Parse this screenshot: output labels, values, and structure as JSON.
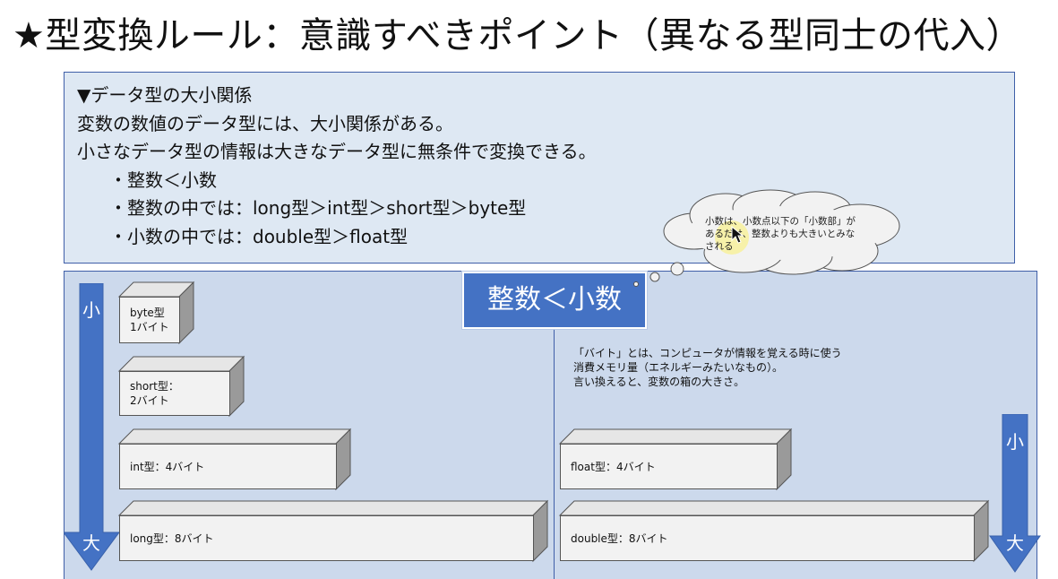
{
  "slide_title": "★型変換ルール：意識すべきポイント（異なる型同士の代入）",
  "info": {
    "heading": "▼データ型の大小関係",
    "line1": "変数の数値のデータ型には、大小関係がある。",
    "line2": "小さなデータ型の情報は大きなデータ型に無条件で変換できる。",
    "bullet1": "・整数＜小数",
    "bullet2": "・整数の中では：long型＞int型＞short型＞byte型",
    "bullet3": "・小数の中では：double型＞float型"
  },
  "left_arrow": {
    "top_label": "小",
    "bottom_label": "大"
  },
  "right_arrow": {
    "top_label": "小",
    "bottom_label": "大"
  },
  "boxes": {
    "byte": {
      "name": "byte型",
      "size": "1バイト"
    },
    "short": {
      "name": "short型：",
      "size": "2バイト"
    },
    "int": {
      "label": "int型：4バイト"
    },
    "long": {
      "label": "long型：8バイト"
    },
    "float": {
      "label": "float型：4バイト"
    },
    "double": {
      "label": "double型：8バイト"
    }
  },
  "big_label": "整数＜小数",
  "byte_note": {
    "line1": "「バイト」とは、コンピュータが情報を覚える時に使う",
    "line2": "消費メモリ量（エネルギーみたいなもの）。",
    "line3": "言い換えると、変数の箱の大きさ。"
  },
  "cloud_note": "小数は、小数点以下の「小数部」があるだけ、整数よりも大きいとみなされる",
  "colors": {
    "arrow_blue": "#4472c4",
    "info_bg": "#dee8f3",
    "lower_bg": "#ccd9ec",
    "border_blue": "#3f5fa8"
  }
}
